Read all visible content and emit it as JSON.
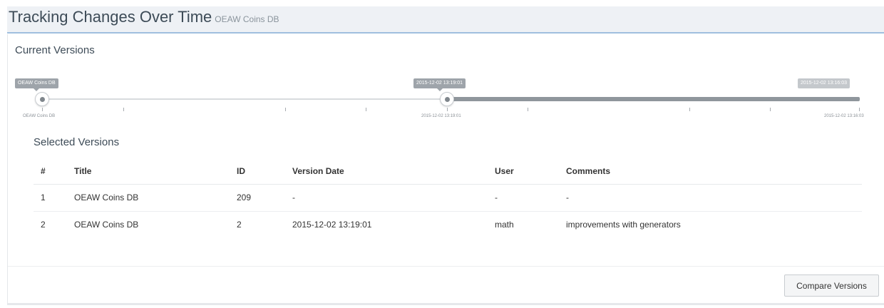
{
  "header": {
    "title": "Tracking Changes Over Time",
    "subtitle": "OEAW Coins DB"
  },
  "panel": {
    "heading": "Current Versions",
    "slider": {
      "start_tag": "OEAW Coins DB",
      "selected_tag": "2015-12-02 13:19:01",
      "end_tag": "2015-12-02 13:16:03",
      "tick_labels": {
        "start": "OEAW Coins DB",
        "middle": "2015-12-02 13:19:01",
        "end": "2015-12-02 13:16:03"
      }
    },
    "selected_heading": "Selected Versions",
    "table": {
      "columns": {
        "num": "#",
        "title": "Title",
        "id": "ID",
        "date": "Version Date",
        "user": "User",
        "comments": "Comments"
      },
      "rows": [
        {
          "num": "1",
          "title": "OEAW Coins DB",
          "id": "209",
          "date": "-",
          "user": "-",
          "comments": "-"
        },
        {
          "num": "2",
          "title": "OEAW Coins DB",
          "id": "2",
          "date": "2015-12-02 13:19:01",
          "user": "math",
          "comments": "improvements with generators"
        }
      ]
    }
  },
  "footer": {
    "compare_label": "Compare Versions"
  }
}
